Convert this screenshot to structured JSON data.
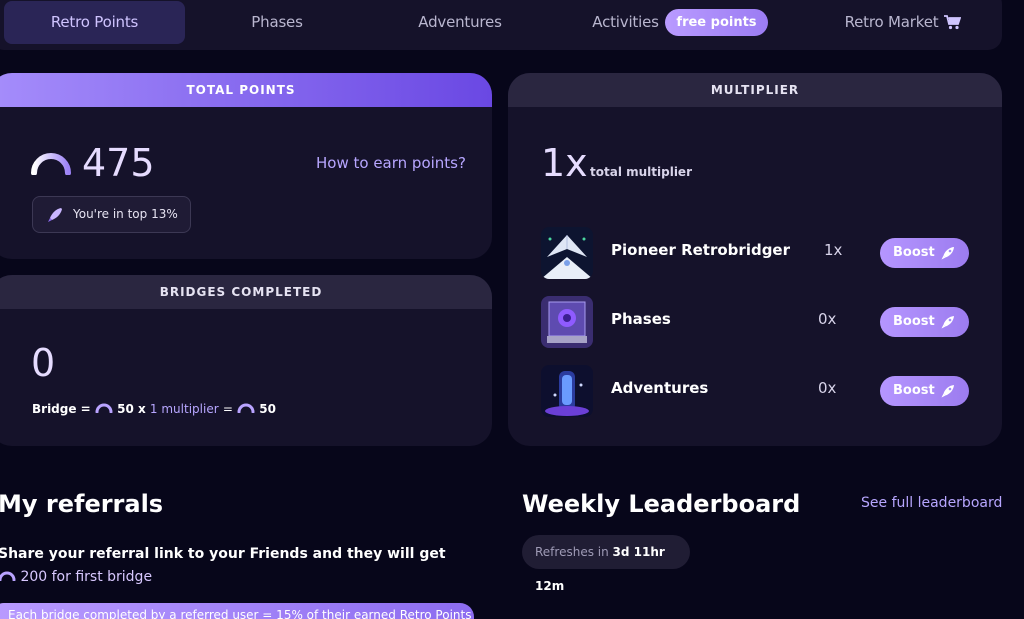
{
  "nav": {
    "items": [
      {
        "label": "Retro Points"
      },
      {
        "label": "Phases"
      },
      {
        "label": "Adventures"
      },
      {
        "label": "Activities"
      },
      {
        "label": "Retro Market"
      }
    ],
    "free_points": "free points",
    "cart_icon": "cart-icon"
  },
  "total_points": {
    "heading": "TOTAL POINTS",
    "value": "475",
    "how_to": "How to earn points?",
    "rank": "You're in top 13%"
  },
  "bridges": {
    "heading": "BRIDGES COMPLETED",
    "value": "0",
    "formula": {
      "prefix": "Bridge =",
      "base": "50 x",
      "multiplier": "1 multiplier",
      "equals": "=",
      "result": "50"
    }
  },
  "multiplier": {
    "heading": "MULTIPLIER",
    "value": "1x",
    "caption": "total multiplier",
    "boost_label": "Boost",
    "rows": [
      {
        "name": "Pioneer Retrobridger",
        "value": "1x"
      },
      {
        "name": "Phases",
        "value": "0x"
      },
      {
        "name": "Adventures",
        "value": "0x"
      }
    ]
  },
  "referrals": {
    "title": "My referrals",
    "text": "Share your referral link to your Friends and they will get",
    "bonus": "200 for first bridge",
    "banner": "Each bridge completed by a referred user = 15% of their earned Retro Points"
  },
  "leaderboard": {
    "title": "Weekly Leaderboard",
    "see_full": "See full leaderboard",
    "refresh_label": "Refreshes in",
    "refresh_time": "3d 11hr 12m"
  },
  "colors": {
    "background": "#07061a",
    "card": "#15122a",
    "accent": "#a58dfb",
    "accent_dark": "#6a48e3"
  }
}
